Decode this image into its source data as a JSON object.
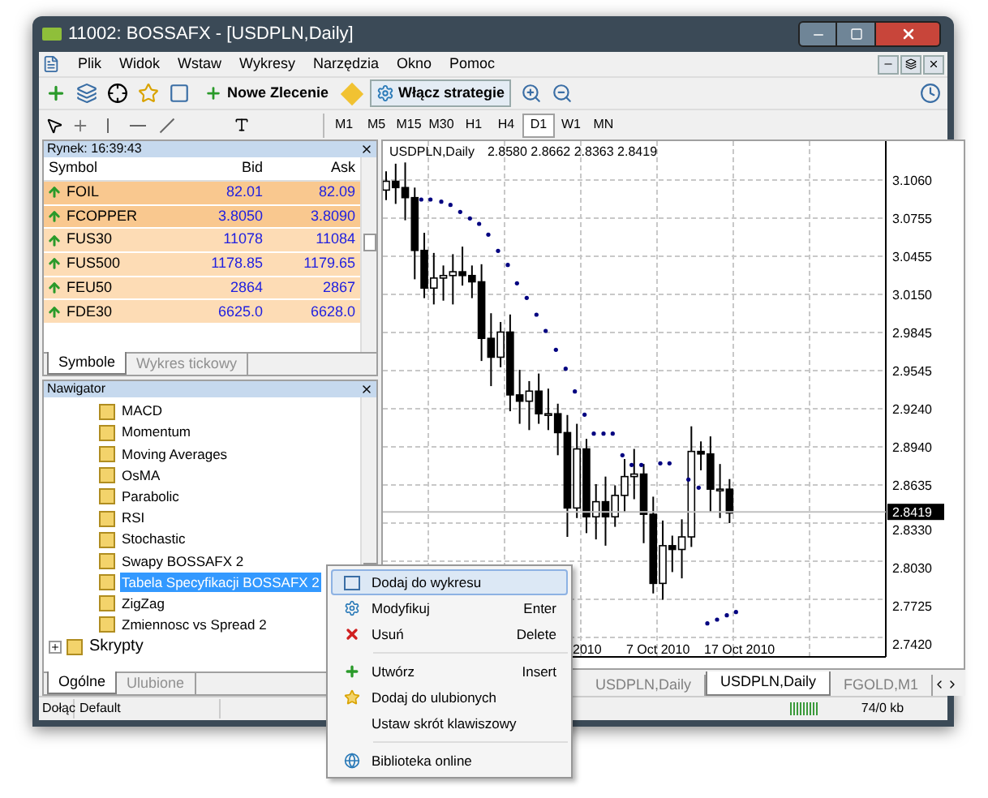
{
  "window": {
    "title": "11002: BOSSAFX - [USDPLN,Daily]"
  },
  "menu": [
    "Plik",
    "Widok",
    "Wstaw",
    "Wykresy",
    "Narzędzia",
    "Okno",
    "Pomoc"
  ],
  "toolbar": {
    "order_button": "Nowe Zlecenie",
    "strategy_button": "Włącz strategie"
  },
  "timeframes": [
    {
      "label": "M1",
      "selected": false
    },
    {
      "label": "M5",
      "selected": false
    },
    {
      "label": "M15",
      "selected": false
    },
    {
      "label": "M30",
      "selected": false
    },
    {
      "label": "H1",
      "selected": false
    },
    {
      "label": "H4",
      "selected": false
    },
    {
      "label": "D1",
      "selected": true
    },
    {
      "label": "W1",
      "selected": false
    },
    {
      "label": "MN",
      "selected": false
    }
  ],
  "market_watch": {
    "title": "Rynek: 16:39:43",
    "columns": [
      "Symbol",
      "Bid",
      "Ask"
    ],
    "rows": [
      {
        "symbol": "FOIL",
        "bid": "82.01",
        "ask": "82.09",
        "selected": true
      },
      {
        "symbol": "FCOPPER",
        "bid": "3.8050",
        "ask": "3.8090",
        "selected": true
      },
      {
        "symbol": "FUS30",
        "bid": "11078",
        "ask": "11084",
        "selected": false
      },
      {
        "symbol": "FUS500",
        "bid": "1178.85",
        "ask": "1179.65",
        "selected": false
      },
      {
        "symbol": "FEU50",
        "bid": "2864",
        "ask": "2867",
        "selected": false
      },
      {
        "symbol": "FDE30",
        "bid": "6625.0",
        "ask": "6628.0",
        "selected": false
      }
    ],
    "tabs": [
      {
        "label": "Symbole",
        "selected": true
      },
      {
        "label": "Wykres tickowy",
        "selected": false
      }
    ]
  },
  "navigator": {
    "title": "Nawigator",
    "tree": [
      {
        "children": [
          {
            "label": "MACD",
            "selected": false
          },
          {
            "label": "Momentum",
            "selected": false
          },
          {
            "label": "Moving Averages",
            "selected": false
          },
          {
            "label": "OsMA",
            "selected": false
          },
          {
            "label": "Parabolic",
            "selected": false
          },
          {
            "label": "RSI",
            "selected": false
          },
          {
            "label": "Stochastic",
            "selected": false
          },
          {
            "label": "Swapy BOSSAFX 2",
            "selected": false
          },
          {
            "label": "Tabela Specyfikacji BOSSAFX 2",
            "selected": true
          },
          {
            "label": "ZigZag",
            "selected": false
          },
          {
            "label": "Zmiennosc vs Spread 2",
            "selected": false
          }
        ]
      },
      {
        "label": "Skrypty",
        "expanded": false,
        "selected": false
      }
    ],
    "tabs": [
      {
        "label": "Ogólne",
        "selected": true
      },
      {
        "label": "Ulubione",
        "selected": false
      }
    ]
  },
  "chart": {
    "symbol": "USDPLN,Daily",
    "ohlc": "2.8580 2.8662 2.8363 2.8419",
    "price_labels": [
      "3.1060",
      "3.0755",
      "3.0455",
      "3.0150",
      "2.9845",
      "2.9545",
      "2.9240",
      "2.8940",
      "2.8635",
      "2.8330",
      "2.8030",
      "2.7725",
      "2.7420"
    ],
    "current_price": "2.8419",
    "date_labels": [
      "2010",
      "7 Oct 2010",
      "17 Oct 2010"
    ]
  },
  "chart_tabs": [
    {
      "label": "USDPLN,Daily",
      "selected": false
    },
    {
      "label": "USDPLN,Daily",
      "selected": true
    },
    {
      "label": "FGOLD,M1",
      "selected": false
    }
  ],
  "status_bar": {
    "connect": "Dołąc",
    "profile": "Default",
    "traffic": "74/0 kb"
  },
  "context_menu": [
    {
      "kind": "item",
      "label": "Dodaj do wykresu",
      "selected": true
    },
    {
      "kind": "item",
      "label": "Modyfikuj",
      "shortcut": "Enter",
      "selected": false
    },
    {
      "kind": "item",
      "label": "Usuń",
      "shortcut": "Delete",
      "selected": false
    },
    {
      "kind": "separator"
    },
    {
      "kind": "item",
      "label": "Utwórz",
      "shortcut": "Insert",
      "selected": false
    },
    {
      "kind": "item",
      "label": "Dodaj do ulubionych",
      "selected": false
    },
    {
      "kind": "item",
      "label": "Ustaw skrót klawiszowy",
      "selected": false
    },
    {
      "kind": "separator"
    },
    {
      "kind": "item",
      "label": "Biblioteka online",
      "selected": false
    }
  ]
}
